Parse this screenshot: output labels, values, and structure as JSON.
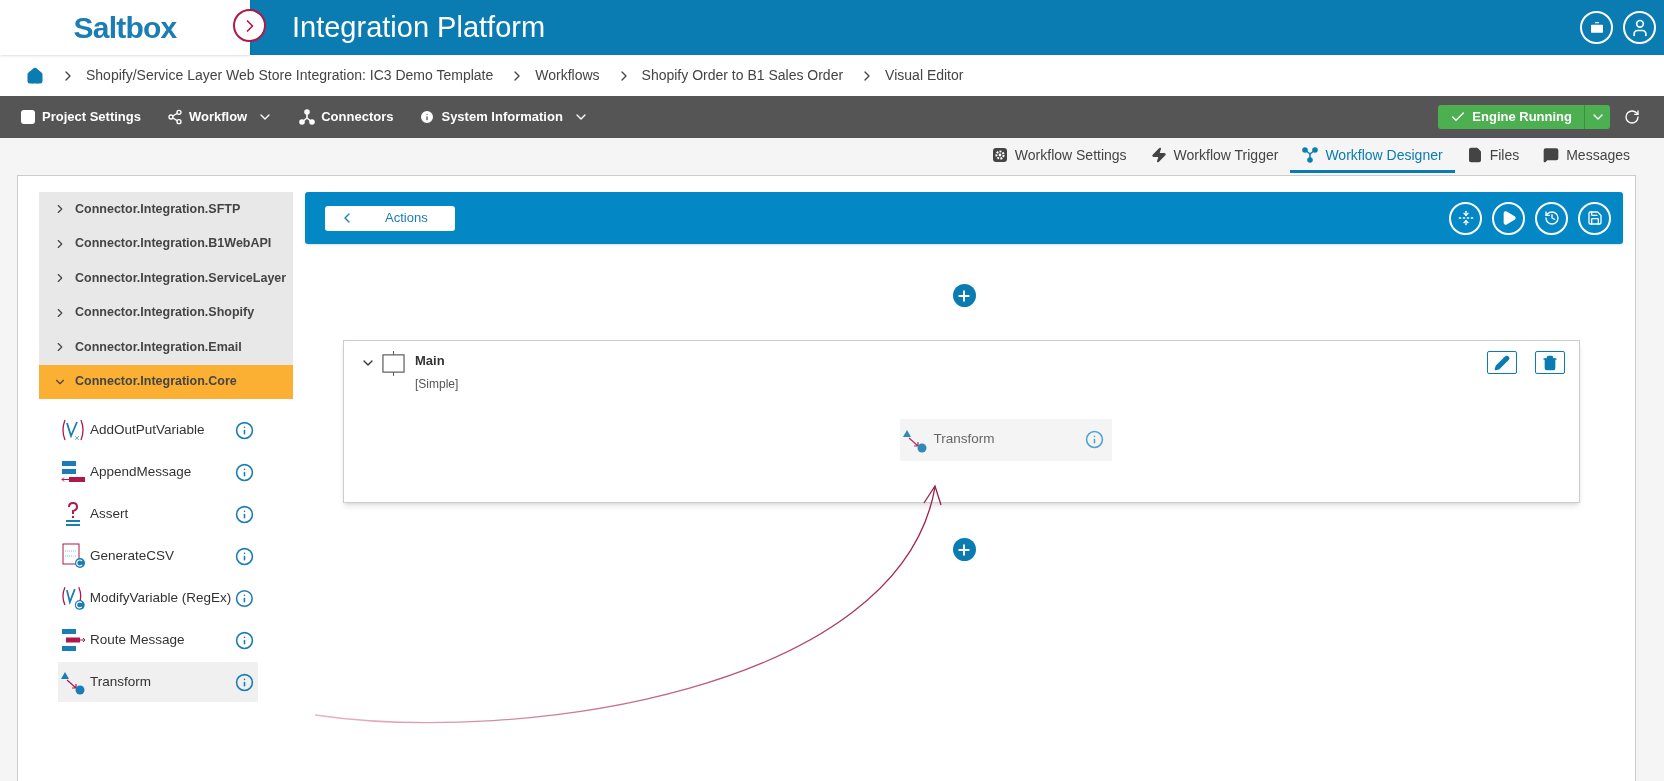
{
  "header": {
    "logo": "Saltbox",
    "title": "Integration Platform"
  },
  "breadcrumb": [
    "Shopify/Service Layer Web Store Integration: IC3 Demo Template",
    "Workflows",
    "Shopify Order to B1 Sales Order",
    "Visual Editor"
  ],
  "menu": [
    {
      "label": "Project Settings",
      "kind": "settings",
      "dropdown": false
    },
    {
      "label": "Workflow",
      "kind": "share",
      "dropdown": true
    },
    {
      "label": "Connectors",
      "kind": "connectors",
      "dropdown": false
    },
    {
      "label": "System Information",
      "kind": "info",
      "dropdown": true
    }
  ],
  "engine": {
    "label": "Engine Running",
    "running": true
  },
  "tabs": [
    {
      "label": "Workflow Settings",
      "kind": "settings",
      "selected": false
    },
    {
      "label": "Workflow Trigger",
      "kind": "trigger",
      "selected": false
    },
    {
      "label": "Workflow Designer",
      "kind": "designer",
      "selected": true
    },
    {
      "label": "Files",
      "kind": "file",
      "selected": false
    },
    {
      "label": "Messages",
      "kind": "messages",
      "selected": false
    }
  ],
  "sidebar": {
    "groups": [
      {
        "label": "Connector.Integration.SFTP",
        "expanded": false
      },
      {
        "label": "Connector.Integration.B1WebAPI",
        "expanded": false
      },
      {
        "label": "Connector.Integration.ServiceLayer",
        "expanded": false
      },
      {
        "label": "Connector.Integration.Shopify",
        "expanded": false
      },
      {
        "label": "Connector.Integration.Email",
        "expanded": false
      },
      {
        "label": "Connector.Integration.Core",
        "expanded": true,
        "children": [
          {
            "label": "AddOutPutVariable",
            "kind": "variable",
            "selected": false
          },
          {
            "label": "AppendMessage",
            "kind": "append",
            "selected": false
          },
          {
            "label": "Assert",
            "kind": "assert",
            "selected": false
          },
          {
            "label": "GenerateCSV",
            "kind": "csv",
            "selected": false
          },
          {
            "label": "ModifyVariable (RegEx)",
            "kind": "modify",
            "selected": false
          },
          {
            "label": "Route Message",
            "kind": "route",
            "selected": false
          },
          {
            "label": "Transform",
            "kind": "transform",
            "selected": true
          }
        ]
      }
    ]
  },
  "editor": {
    "back_button": "Actions",
    "block": {
      "title": "Main",
      "subtitle": "[Simple]",
      "expanded": true,
      "nodes": [
        {
          "label": "Transform",
          "kind": "transform"
        }
      ]
    }
  }
}
